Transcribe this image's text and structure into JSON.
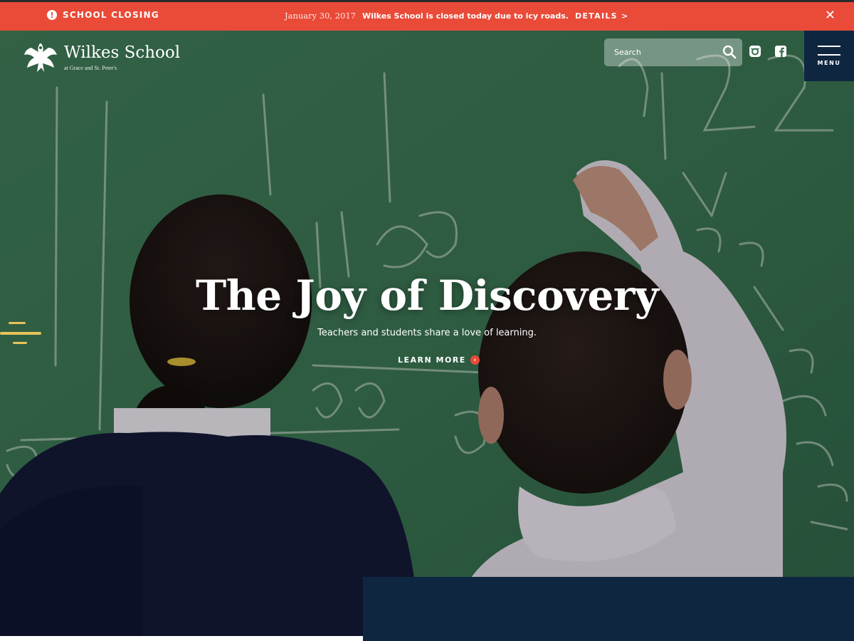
{
  "alert": {
    "label": "SCHOOL CLOSING",
    "icon": "alert-icon",
    "date": "January 30, 2017",
    "message": "Wilkes School is closed today due to icy roads.",
    "details_label": "DETAILS >",
    "close_glyph": "✕",
    "color": "#ea4a38"
  },
  "header": {
    "logo_name": "Wilkes School",
    "logo_sub": "at Grace and St. Peter's",
    "search_placeholder": "Search",
    "search_icon": "search-icon",
    "social_icons": [
      "instagram-icon",
      "facebook-icon"
    ],
    "menu_label": "MENU",
    "menu_color": "#0f2640"
  },
  "hero": {
    "title": "The Joy of Discovery",
    "subtitle": "Teachers and students share a love of learning.",
    "cta_label": "LEARN MORE",
    "cta_icon_glyph": "›"
  }
}
